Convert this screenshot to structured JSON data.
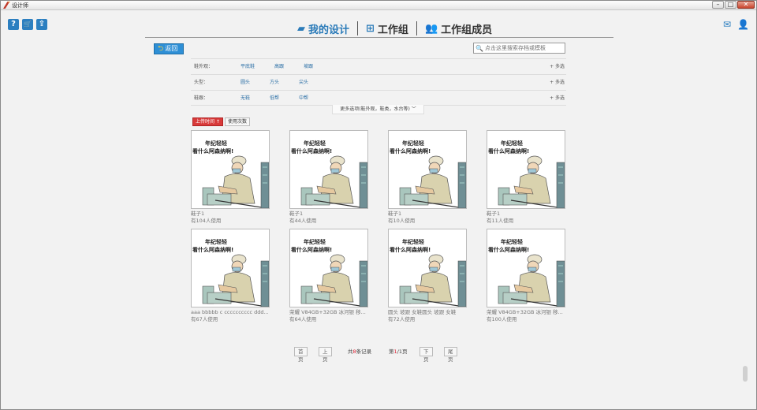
{
  "window": {
    "title": "设计师",
    "buttons": [
      "–",
      "□",
      "✕"
    ]
  },
  "left_icons": [
    {
      "name": "help-icon",
      "glyph": "?"
    },
    {
      "name": "cart-icon",
      "glyph": "🛒"
    },
    {
      "name": "upload-icon",
      "glyph": "⇪"
    }
  ],
  "right_icons": [
    {
      "name": "mail-icon",
      "glyph": "✉"
    },
    {
      "name": "user-icon",
      "glyph": "👤"
    }
  ],
  "topnav": {
    "tabs": [
      {
        "label": "我的设计",
        "icon": "folder-icon",
        "glyph": "▰",
        "active": true
      },
      {
        "label": "工作组",
        "icon": "org-chart-icon",
        "glyph": "⊞",
        "active": false
      },
      {
        "label": "工作组成员",
        "icon": "members-icon",
        "glyph": "👥",
        "active": false
      }
    ]
  },
  "back_label": "返回",
  "search": {
    "placeholder": "点击这里搜索存档或模板"
  },
  "filters": [
    {
      "label": "鞋外观：",
      "options": [
        "平底鞋",
        "高跟",
        "坡跟"
      ],
      "more": "+ 多选"
    },
    {
      "label": "头型：",
      "options": [
        "圆头",
        "方头",
        "尖头"
      ],
      "more": "+ 多选"
    },
    {
      "label": "鞋跟：",
      "options": [
        "无鞋",
        "低帮",
        "中帮"
      ],
      "more": "+ 多选"
    }
  ],
  "more_options": "更多选项(鞋外观，鞋类，水台等) ﹀",
  "sort": [
    "上传时间 ↑",
    "使用次数"
  ],
  "card_caption": [
    "年纪轻轻",
    "看什么阿森纳啊!"
  ],
  "cards": [
    {
      "name": "鞋子1",
      "uses": "有104人使用"
    },
    {
      "name": "鞋子1",
      "uses": "有44人使用"
    },
    {
      "name": "鞋子1",
      "uses": "有10人使用"
    },
    {
      "name": "鞋子1",
      "uses": "有11人使用"
    },
    {
      "name": "aaa bbbbb c cccccccccc ddd...",
      "uses": "有67人使用"
    },
    {
      "name": "荣耀 V84GB+32GB 冰河银 移...",
      "uses": "有64人使用"
    },
    {
      "name": "圆头 坡跟 女鞋圆头 坡跟 女鞋",
      "uses": "有72人使用"
    },
    {
      "name": "荣耀 V84GB+32GB 冰河银 移...",
      "uses": "有100人使用"
    }
  ],
  "pager": {
    "first": "首页",
    "prev": "上页",
    "total_prefix": "共",
    "total_count": "8",
    "total_suffix": "条记录",
    "page_prefix": "第",
    "page_current": "1",
    "page_sep": "/1页",
    "next": "下页",
    "last": "尾页"
  }
}
